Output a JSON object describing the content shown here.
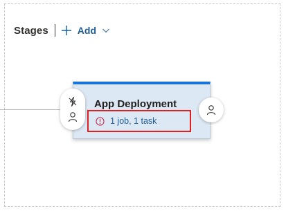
{
  "pipeline": {
    "stages_title": "Stages",
    "add_label": "Add",
    "icons": {
      "add": "plus-icon",
      "add_dropdown": "chevron-down-icon",
      "pre_trigger": "lightning-icon",
      "pre_approvals": "person-icon",
      "post_approvals": "person-icon",
      "job_warning": "exclamation-circle-icon"
    },
    "colors": {
      "accent": "#1a73d6",
      "card_bg": "#dde8f5",
      "link": "#1f5d93",
      "highlight": "#e02020"
    }
  },
  "stage": {
    "name": "App Deployment",
    "job_summary": "1 job, 1 task"
  }
}
